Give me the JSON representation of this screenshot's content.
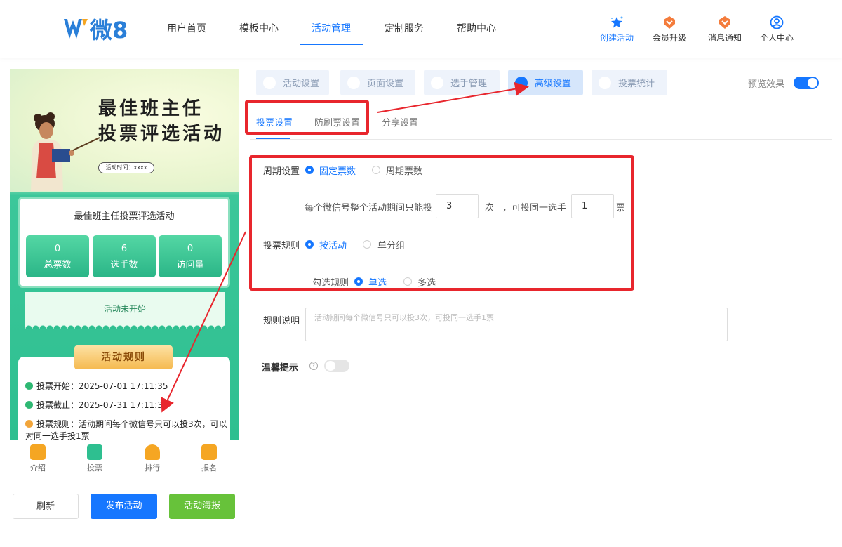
{
  "header": {
    "logo_text": "微8",
    "nav": [
      {
        "label": "用户首页"
      },
      {
        "label": "模板中心"
      },
      {
        "label": "活动管理"
      },
      {
        "label": "定制服务"
      },
      {
        "label": "帮助中心"
      }
    ],
    "tools": [
      {
        "label": "创建活动",
        "icon": "star-icon"
      },
      {
        "label": "会员升级",
        "icon": "badge-icon"
      },
      {
        "label": "消息通知",
        "icon": "bell-icon"
      },
      {
        "label": "个人中心",
        "icon": "user-icon"
      }
    ]
  },
  "preview": {
    "title_line1": "最佳班主任",
    "title_line2": "投票评选活动",
    "activity_time": "活动时间：xxxx",
    "card_title": "最佳班主任投票评选活动",
    "stats": [
      {
        "value": "0",
        "label": "总票数"
      },
      {
        "value": "6",
        "label": "选手数"
      },
      {
        "value": "0",
        "label": "访问量"
      }
    ],
    "status": "活动未开始",
    "rules_title": "活动规则",
    "rules": [
      {
        "text": "投票开始：2025-07-01 17:11:35",
        "color": "#2eb873"
      },
      {
        "text": "投票截止：2025-07-31 17:11:35",
        "color": "#2eb873"
      },
      {
        "text": "投票规则：活动期间每个微信号只可以投3次，可以对同一选手投1票",
        "color": "#f2a53a"
      }
    ],
    "tabbar": [
      {
        "label": "介绍",
        "color": "#f5a623"
      },
      {
        "label": "投票",
        "color": "#2ebf90"
      },
      {
        "label": "排行",
        "color": "#f5a623"
      },
      {
        "label": "报名",
        "color": "#f5a623"
      }
    ]
  },
  "buttons": {
    "refresh": "刷新",
    "publish": "发布活动",
    "poster": "活动海报"
  },
  "settings": {
    "tabs": [
      {
        "label": "活动设置"
      },
      {
        "label": "页面设置"
      },
      {
        "label": "选手管理"
      },
      {
        "label": "高级设置"
      },
      {
        "label": "投票统计"
      }
    ],
    "preview_label": "预览效果",
    "preview_on": true,
    "inner_tabs": [
      {
        "label": "投票设置"
      },
      {
        "label": "防刷票设置"
      },
      {
        "label": "分享设置"
      }
    ],
    "period_label": "周期设置",
    "period_options": [
      "固定票数",
      "周期票数"
    ],
    "votes_text_1": "每个微信号整个活动期间只能投",
    "votes_count": "3",
    "votes_unit_1": "次",
    "votes_text_2": "，可投同一选手",
    "votes_same": "1",
    "votes_unit_2": "票",
    "rule_label": "投票规则",
    "rule_options": [
      "按活动",
      "单分组"
    ],
    "select_label": "勾选规则",
    "select_options": [
      "单选",
      "多选"
    ],
    "desc_label": "规则说明",
    "desc_placeholder": "活动期间每个微信号只可以投3次，可投同一选手1票",
    "tip_label": "温馨提示",
    "tip_on": false,
    "help_glyph": "?"
  },
  "colors": {
    "primary": "#1677ff",
    "green": "#67c23a",
    "annotation": "#e8262d"
  }
}
